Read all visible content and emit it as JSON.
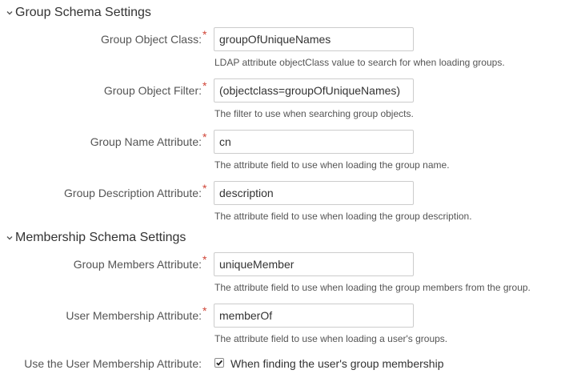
{
  "group_schema": {
    "title": "Group Schema Settings",
    "fields": {
      "object_class": {
        "label": "Group Object Class:",
        "value": "groupOfUniqueNames",
        "description": "LDAP attribute objectClass value to search for when loading groups."
      },
      "object_filter": {
        "label": "Group Object Filter:",
        "value": "(objectclass=groupOfUniqueNames)",
        "description": "The filter to use when searching group objects."
      },
      "name_attribute": {
        "label": "Group Name Attribute:",
        "value": "cn",
        "description": "The attribute field to use when loading the group name."
      },
      "description_attribute": {
        "label": "Group Description Attribute:",
        "value": "description",
        "description": "The attribute field to use when loading the group description."
      }
    }
  },
  "membership_schema": {
    "title": "Membership Schema Settings",
    "fields": {
      "members_attribute": {
        "label": "Group Members Attribute:",
        "value": "uniqueMember",
        "description": "The attribute field to use when loading the group members from the group."
      },
      "user_membership_attribute": {
        "label": "User Membership Attribute:",
        "value": "memberOf",
        "description": "The attribute field to use when loading a user's groups."
      }
    },
    "use_membership": {
      "label": "Use the User Membership Attribute:",
      "checkbox_label": "When finding the user's group membership",
      "checked": true
    }
  },
  "required_marker": "*",
  "colors": {
    "required": "#d04437",
    "text": "#333333",
    "label": "#555555",
    "border": "#cccccc"
  }
}
